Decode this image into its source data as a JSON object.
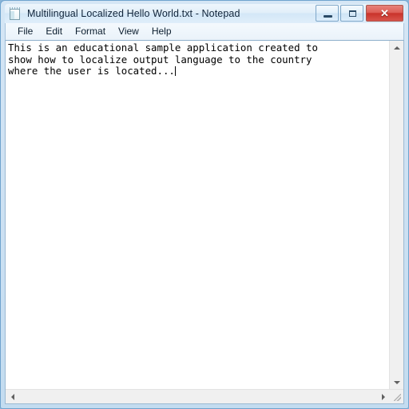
{
  "window": {
    "title": "Multilingual Localized Hello World.txt - Notepad",
    "app_icon": "notepad-icon",
    "accent_border": "#6fa3ce",
    "titlebar_color": "#dfeefa",
    "close_button_color": "#c9332b"
  },
  "controls": {
    "minimize_label": "–",
    "minimize_name": "minimize-icon",
    "maximize_label": "□",
    "maximize_name": "maximize-icon",
    "close_label": "✕",
    "close_name": "close-icon"
  },
  "menubar": {
    "items": [
      {
        "label": "File"
      },
      {
        "label": "Edit"
      },
      {
        "label": "Format"
      },
      {
        "label": "View"
      },
      {
        "label": "Help"
      }
    ]
  },
  "editor": {
    "lines": [
      "This is an educational sample application created to",
      "show how to localize output language to the country",
      "where the user is located..."
    ],
    "caret_visible": true,
    "text_color": "#000000",
    "background_color": "#ffffff"
  },
  "scrollbars": {
    "vertical": {
      "up_arrow": "scroll-up-icon",
      "down_arrow": "scroll-down-icon"
    },
    "horizontal": {
      "left_arrow": "scroll-left-icon",
      "right_arrow": "scroll-right-icon"
    },
    "resize_grip": "resize-grip-icon"
  }
}
